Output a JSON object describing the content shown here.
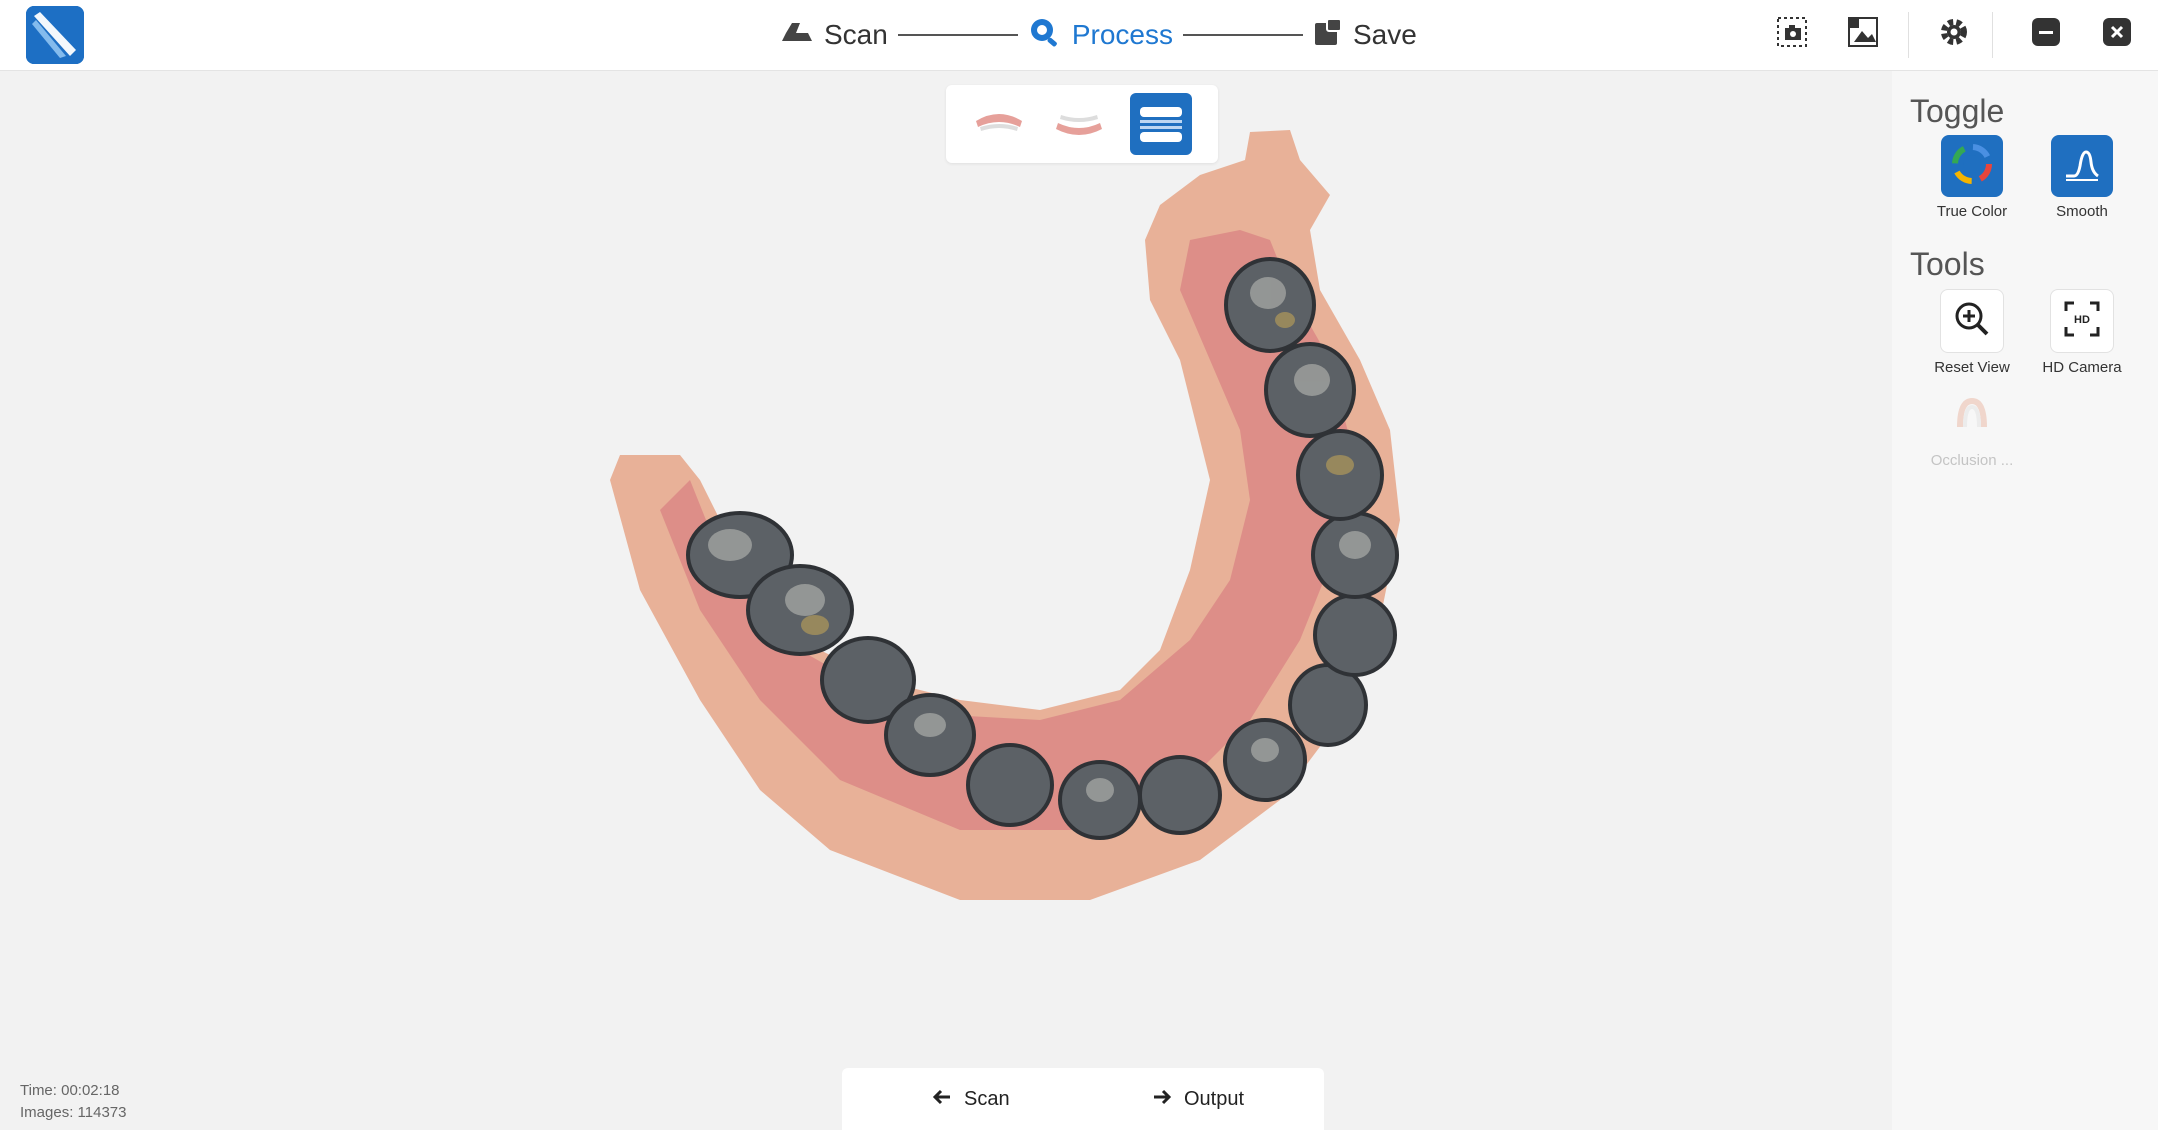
{
  "steps": [
    {
      "label": "Scan",
      "icon": "scanner-icon"
    },
    {
      "label": "Process",
      "icon": "process-icon"
    },
    {
      "label": "Save",
      "icon": "save-icon"
    }
  ],
  "active_step": "Process",
  "accent_color": "#1f6fc0",
  "jaw_views": [
    {
      "name": "upper-jaw",
      "selected": false
    },
    {
      "name": "lower-jaw",
      "selected": false
    },
    {
      "name": "both-jaws",
      "selected": true
    }
  ],
  "panel": {
    "toggle_heading": "Toggle",
    "toggle_items": [
      "True Color",
      "Smooth"
    ],
    "tools_heading": "Tools",
    "tool_items": [
      "Reset View",
      "HD Camera",
      "Occlusion ..."
    ]
  },
  "bottom_nav": {
    "back_label": "Scan",
    "next_label": "Output"
  },
  "status": {
    "time": "Time: 00:02:18",
    "images": "Images: 114373"
  }
}
